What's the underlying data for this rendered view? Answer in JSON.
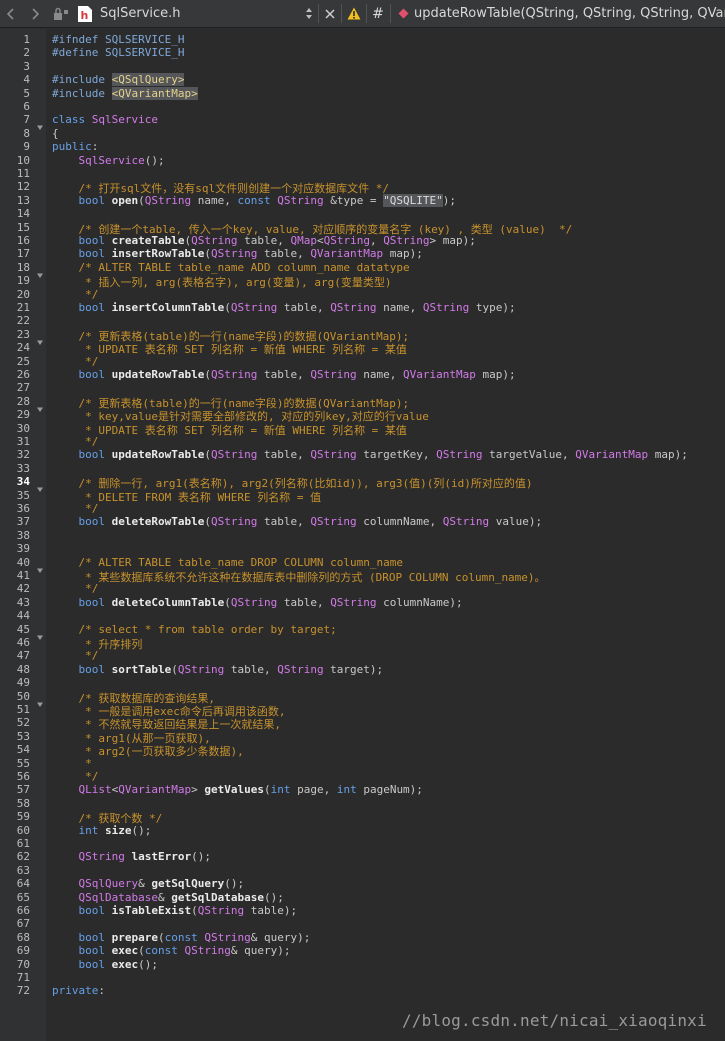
{
  "toolbar": {
    "file_name": "SqlService.h",
    "function_breadcrumb": "updateRowTable(QString, QString, QString, QVariant"
  },
  "editor": {
    "current_line": 34,
    "lines": [
      [
        [
          "pp",
          "#ifndef SQLSERVICE_H"
        ]
      ],
      [
        [
          "pp",
          "#define SQLSERVICE_H"
        ]
      ],
      [],
      [
        [
          "pp",
          "#include "
        ],
        [
          "hl",
          "<QSqlQuery>"
        ]
      ],
      [
        [
          "pp",
          "#include "
        ],
        [
          "hl",
          "<QVariantMap>"
        ]
      ],
      [],
      [
        [
          "kw",
          "class "
        ],
        [
          "ty",
          "SqlService"
        ]
      ],
      [
        [
          "",
          "{"
        ]
      ],
      [
        [
          "kw",
          "public"
        ],
        [
          "",
          ":"
        ]
      ],
      [
        [
          "",
          "    "
        ],
        [
          "ty",
          "SqlService"
        ],
        [
          "",
          "();"
        ]
      ],
      [],
      [
        [
          "",
          "    "
        ],
        [
          "cm",
          "/* 打开sql文件，没有sql文件则创建一个对应数据库文件 */"
        ]
      ],
      [
        [
          "",
          "    "
        ],
        [
          "kw",
          "bool "
        ],
        [
          "fn",
          "open"
        ],
        [
          "",
          "("
        ],
        [
          "ty",
          "QString"
        ],
        [
          "",
          " name, "
        ],
        [
          "kw",
          "const "
        ],
        [
          "ty",
          "QString"
        ],
        [
          "",
          " &type = "
        ],
        [
          "st",
          "\"QSQLITE\""
        ],
        [
          "",
          ");"
        ]
      ],
      [],
      [
        [
          "",
          "    "
        ],
        [
          "cm",
          "/* 创建一个table, 传入一个key, value, 对应顺序的变量名字 (key) , 类型 (value)  */"
        ]
      ],
      [
        [
          "",
          "    "
        ],
        [
          "kw",
          "bool "
        ],
        [
          "fn",
          "createTable"
        ],
        [
          "",
          "("
        ],
        [
          "ty",
          "QString"
        ],
        [
          "",
          " table, "
        ],
        [
          "ty",
          "QMap"
        ],
        [
          "",
          "<"
        ],
        [
          "ty",
          "QString"
        ],
        [
          "",
          ", "
        ],
        [
          "ty",
          "QString"
        ],
        [
          "",
          "> map);"
        ]
      ],
      [
        [
          "",
          "    "
        ],
        [
          "kw",
          "bool "
        ],
        [
          "fn",
          "insertRowTable"
        ],
        [
          "",
          "("
        ],
        [
          "ty",
          "QString"
        ],
        [
          "",
          " table, "
        ],
        [
          "ty",
          "QVariantMap"
        ],
        [
          "",
          " map);"
        ]
      ],
      [
        [
          "",
          "    "
        ],
        [
          "cm",
          "/* ALTER TABLE table_name ADD column_name datatype"
        ]
      ],
      [
        [
          "",
          "    "
        ],
        [
          "cm",
          " * 插入一列, arg(表格名字), arg(变量), arg(变量类型)"
        ]
      ],
      [
        [
          "",
          "    "
        ],
        [
          "cm",
          " */"
        ]
      ],
      [
        [
          "",
          "    "
        ],
        [
          "kw",
          "bool "
        ],
        [
          "fn",
          "insertColumnTable"
        ],
        [
          "",
          "("
        ],
        [
          "ty",
          "QString"
        ],
        [
          "",
          " table, "
        ],
        [
          "ty",
          "QString"
        ],
        [
          "",
          " name, "
        ],
        [
          "ty",
          "QString"
        ],
        [
          "",
          " type);"
        ]
      ],
      [],
      [
        [
          "",
          "    "
        ],
        [
          "cm",
          "/* 更新表格(table)的一行(name字段)的数据(QVariantMap);"
        ]
      ],
      [
        [
          "",
          "    "
        ],
        [
          "cm",
          " * UPDATE 表名称 SET 列名称 = 新值 WHERE 列名称 = 某值"
        ]
      ],
      [
        [
          "",
          "    "
        ],
        [
          "cm",
          " */"
        ]
      ],
      [
        [
          "",
          "    "
        ],
        [
          "kw",
          "bool "
        ],
        [
          "fn",
          "updateRowTable"
        ],
        [
          "",
          "("
        ],
        [
          "ty",
          "QString"
        ],
        [
          "",
          " table, "
        ],
        [
          "ty",
          "QString"
        ],
        [
          "",
          " name, "
        ],
        [
          "ty",
          "QVariantMap"
        ],
        [
          "",
          " map);"
        ]
      ],
      [],
      [
        [
          "",
          "    "
        ],
        [
          "cm",
          "/* 更新表格(table)的一行(name字段)的数据(QVariantMap);"
        ]
      ],
      [
        [
          "",
          "    "
        ],
        [
          "cm",
          " * key,value是针对需要全部修改的, 对应的列key,对应的行value"
        ]
      ],
      [
        [
          "",
          "    "
        ],
        [
          "cm",
          " * UPDATE 表名称 SET 列名称 = 新值 WHERE 列名称 = 某值"
        ]
      ],
      [
        [
          "",
          "    "
        ],
        [
          "cm",
          " */"
        ]
      ],
      [
        [
          "",
          "    "
        ],
        [
          "kw",
          "bool "
        ],
        [
          "fn",
          "updateRowTable"
        ],
        [
          "",
          "("
        ],
        [
          "ty",
          "QString"
        ],
        [
          "",
          " table, "
        ],
        [
          "ty",
          "QString"
        ],
        [
          "",
          " targetKey, "
        ],
        [
          "ty",
          "QString"
        ],
        [
          "",
          " targetValue, "
        ],
        [
          "ty",
          "QVariantMap"
        ],
        [
          "",
          " map);"
        ]
      ],
      [],
      [
        [
          "",
          "    "
        ],
        [
          "cm",
          "/* 删除一行, arg1(表名称), arg2(列名称(比如id)), arg3(值)(列(id)所对应的值)"
        ]
      ],
      [
        [
          "",
          "    "
        ],
        [
          "cm",
          " * DELETE FROM 表名称 WHERE 列名称 = 值"
        ]
      ],
      [
        [
          "",
          "    "
        ],
        [
          "cm",
          " */"
        ]
      ],
      [
        [
          "",
          "    "
        ],
        [
          "kw",
          "bool "
        ],
        [
          "fn",
          "deleteRowTable"
        ],
        [
          "",
          "("
        ],
        [
          "ty",
          "QString"
        ],
        [
          "",
          " table, "
        ],
        [
          "ty",
          "QString"
        ],
        [
          "",
          " columnName, "
        ],
        [
          "ty",
          "QString"
        ],
        [
          "",
          " value);"
        ]
      ],
      [],
      [],
      [
        [
          "",
          "    "
        ],
        [
          "cm",
          "/* ALTER TABLE table_name DROP COLUMN column_name"
        ]
      ],
      [
        [
          "",
          "    "
        ],
        [
          "cm",
          " * 某些数据库系统不允许这种在数据库表中删除列的方式 (DROP COLUMN column_name)。"
        ]
      ],
      [
        [
          "",
          "    "
        ],
        [
          "cm",
          " */"
        ]
      ],
      [
        [
          "",
          "    "
        ],
        [
          "kw",
          "bool "
        ],
        [
          "fn",
          "deleteColumnTable"
        ],
        [
          "",
          "("
        ],
        [
          "ty",
          "QString"
        ],
        [
          "",
          " table, "
        ],
        [
          "ty",
          "QString"
        ],
        [
          "",
          " columnName);"
        ]
      ],
      [],
      [
        [
          "",
          "    "
        ],
        [
          "cm",
          "/* select * from table order by target;"
        ]
      ],
      [
        [
          "",
          "    "
        ],
        [
          "cm",
          " * 升序排列"
        ]
      ],
      [
        [
          "",
          "    "
        ],
        [
          "cm",
          " */"
        ]
      ],
      [
        [
          "",
          "    "
        ],
        [
          "kw",
          "bool "
        ],
        [
          "fn",
          "sortTable"
        ],
        [
          "",
          "("
        ],
        [
          "ty",
          "QString"
        ],
        [
          "",
          " table, "
        ],
        [
          "ty",
          "QString"
        ],
        [
          "",
          " target);"
        ]
      ],
      [],
      [
        [
          "",
          "    "
        ],
        [
          "cm",
          "/* 获取数据库的查询结果,"
        ]
      ],
      [
        [
          "",
          "    "
        ],
        [
          "cm",
          " * 一般是调用exec命令后再调用该函数,"
        ]
      ],
      [
        [
          "",
          "    "
        ],
        [
          "cm",
          " * 不然就导致返回结果是上一次就结果,"
        ]
      ],
      [
        [
          "",
          "    "
        ],
        [
          "cm",
          " * arg1(从那一页获取),"
        ]
      ],
      [
        [
          "",
          "    "
        ],
        [
          "cm",
          " * arg2(一页获取多少条数据),"
        ]
      ],
      [
        [
          "",
          "    "
        ],
        [
          "cm",
          " *"
        ]
      ],
      [
        [
          "",
          "    "
        ],
        [
          "cm",
          " */"
        ]
      ],
      [
        [
          "",
          "    "
        ],
        [
          "ty",
          "QList"
        ],
        [
          "",
          "<"
        ],
        [
          "ty",
          "QVariantMap"
        ],
        [
          "",
          "> "
        ],
        [
          "fn",
          "getValues"
        ],
        [
          "",
          "("
        ],
        [
          "kw",
          "int"
        ],
        [
          "",
          " page, "
        ],
        [
          "kw",
          "int"
        ],
        [
          "",
          " pageNum);"
        ]
      ],
      [],
      [
        [
          "",
          "    "
        ],
        [
          "cm",
          "/* 获取个数 */"
        ]
      ],
      [
        [
          "",
          "    "
        ],
        [
          "kw",
          "int "
        ],
        [
          "fn",
          "size"
        ],
        [
          "",
          "();"
        ]
      ],
      [],
      [
        [
          "",
          "    "
        ],
        [
          "ty",
          "QString"
        ],
        [
          "fn",
          " lastError"
        ],
        [
          "",
          "();"
        ]
      ],
      [],
      [
        [
          "",
          "    "
        ],
        [
          "ty",
          "QSqlQuery"
        ],
        [
          "",
          "& "
        ],
        [
          "fn",
          "getSqlQuery"
        ],
        [
          "",
          "();"
        ]
      ],
      [
        [
          "",
          "    "
        ],
        [
          "ty",
          "QSqlDatabase"
        ],
        [
          "",
          "& "
        ],
        [
          "fn",
          "getSqlDatabase"
        ],
        [
          "",
          "();"
        ]
      ],
      [
        [
          "",
          "    "
        ],
        [
          "kw",
          "bool "
        ],
        [
          "fn",
          "isTableExist"
        ],
        [
          "",
          "("
        ],
        [
          "ty",
          "QString"
        ],
        [
          "",
          " table);"
        ]
      ],
      [],
      [
        [
          "",
          "    "
        ],
        [
          "kw",
          "bool "
        ],
        [
          "fn",
          "prepare"
        ],
        [
          "",
          "("
        ],
        [
          "kw",
          "const "
        ],
        [
          "ty",
          "QString"
        ],
        [
          "",
          "& query);"
        ]
      ],
      [
        [
          "",
          "    "
        ],
        [
          "kw",
          "bool "
        ],
        [
          "fn",
          "exec"
        ],
        [
          "",
          "("
        ],
        [
          "kw",
          "const "
        ],
        [
          "ty",
          "QString"
        ],
        [
          "",
          "& query);"
        ]
      ],
      [
        [
          "",
          "    "
        ],
        [
          "kw",
          "bool "
        ],
        [
          "fn",
          "exec"
        ],
        [
          "",
          "();"
        ]
      ],
      [],
      [
        [
          "kw",
          "private"
        ],
        [
          "",
          ":"
        ]
      ]
    ],
    "folded_at": [
      7,
      18,
      23,
      28,
      34,
      40,
      45,
      50
    ]
  },
  "watermark": "//blog.csdn.net/nicai_xiaoqinxi"
}
